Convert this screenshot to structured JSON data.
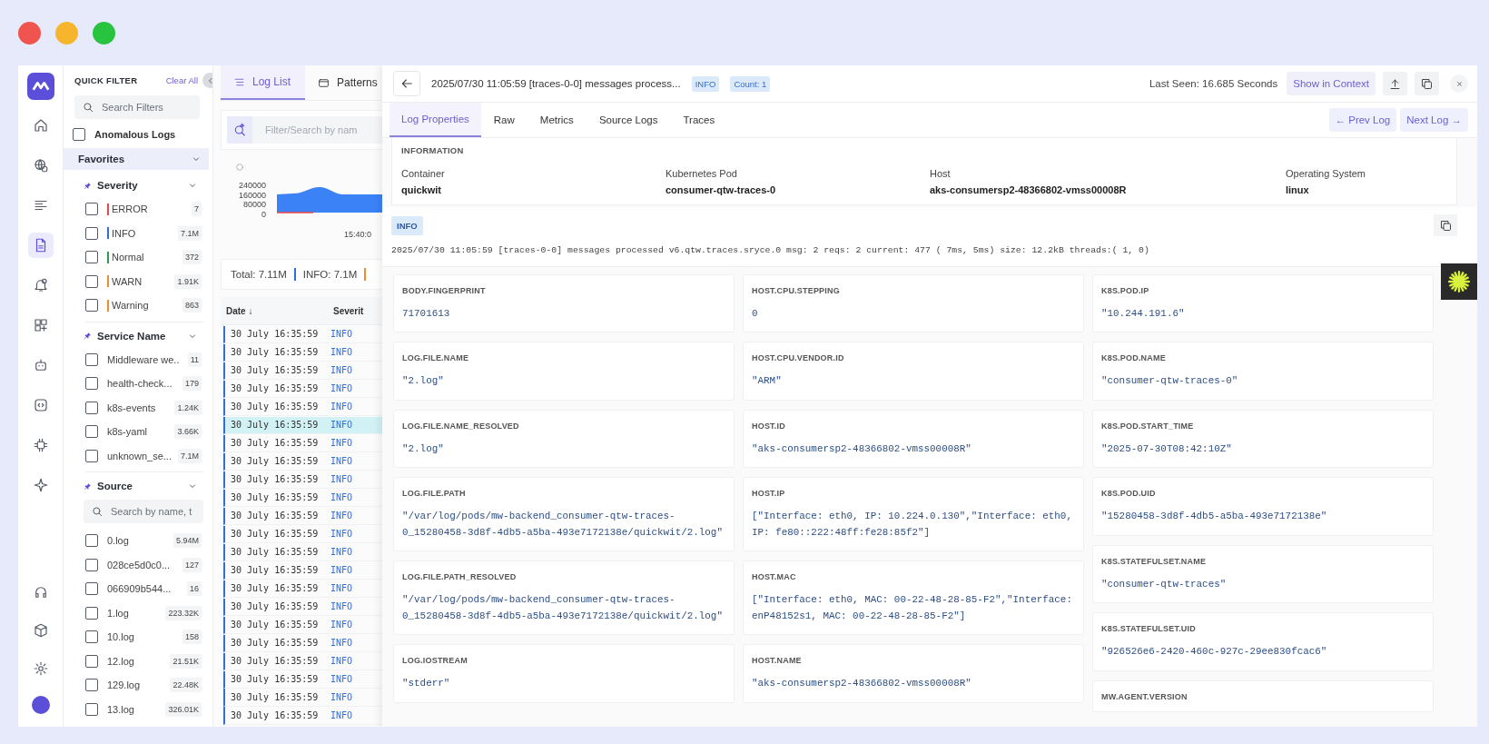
{
  "nav": {
    "items": [
      {
        "kind": "home",
        "selected": false
      },
      {
        "kind": "globe",
        "selected": false
      },
      {
        "kind": "list",
        "selected": false
      },
      {
        "kind": "document",
        "selected": true
      },
      {
        "kind": "bell",
        "selected": false
      },
      {
        "kind": "widget",
        "selected": false
      },
      {
        "kind": "robot",
        "selected": false
      },
      {
        "kind": "code",
        "selected": false
      },
      {
        "kind": "chip",
        "selected": false
      },
      {
        "kind": "sparkle",
        "selected": false
      }
    ],
    "bottom_items": [
      {
        "kind": "headset",
        "selected": false
      },
      {
        "kind": "cube",
        "selected": false
      },
      {
        "kind": "gear",
        "selected": false
      },
      {
        "kind": "avatar",
        "selected": false
      }
    ]
  },
  "filter_panel": {
    "title": "QUICK FILTER",
    "clear_label": "Clear All",
    "search": {
      "placeholder": "Search Filters"
    },
    "anomalous": {
      "label": "Anomalous Logs",
      "checked": false
    },
    "favorites": {
      "label": "Favorites",
      "expanded": true
    },
    "groups": [
      {
        "title": "Severity",
        "pinned": true,
        "expanded": true,
        "options": [
          {
            "label": "ERROR",
            "count": "7",
            "checked": false,
            "color": "#e5484d"
          },
          {
            "label": "INFO",
            "count": "7.1M",
            "checked": false,
            "color": "#2f6fdb"
          },
          {
            "label": "Normal",
            "count": "372",
            "checked": false,
            "color": "#2e9d4f"
          },
          {
            "label": "WARN",
            "count": "1.91K",
            "checked": false,
            "color": "#f08c2e"
          },
          {
            "label": "Warning",
            "count": "863",
            "checked": false,
            "color": "#f08c2e"
          }
        ]
      },
      {
        "title": "Service Name",
        "pinned": true,
        "expanded": true,
        "options": [
          {
            "label": "Middleware we..",
            "count": "11",
            "checked": false
          },
          {
            "label": "health-check...",
            "count": "179",
            "checked": false
          },
          {
            "label": "k8s-events",
            "count": "1.24K",
            "checked": false
          },
          {
            "label": "k8s-yaml",
            "count": "3.66K",
            "checked": false
          },
          {
            "label": "unknown_se...",
            "count": "7.1M",
            "checked": false
          }
        ]
      },
      {
        "title": "Source",
        "pinned": true,
        "expanded": true,
        "search": {
          "placeholder": "Search by name, t"
        },
        "options": [
          {
            "label": "0.log",
            "count": "5.94M",
            "checked": false
          },
          {
            "label": "028ce5d0c0...",
            "count": "127",
            "checked": false
          },
          {
            "label": "066909b544...",
            "count": "16",
            "checked": false
          },
          {
            "label": "1.log",
            "count": "223.32K",
            "checked": false
          },
          {
            "label": "10.log",
            "count": "158",
            "checked": false
          },
          {
            "label": "12.log",
            "count": "21.51K",
            "checked": false
          },
          {
            "label": "129.log",
            "count": "22.48K",
            "checked": false
          },
          {
            "label": "13.log",
            "count": "326.01K",
            "checked": false
          }
        ]
      }
    ]
  },
  "log_list": {
    "tabs": [
      {
        "label": "Log List",
        "kind": "list",
        "selected": true
      },
      {
        "label": "Patterns",
        "kind": "pattern",
        "selected": false
      }
    ],
    "search": {
      "placeholder": "Filter/Search by nam"
    },
    "chart": {
      "ytick_labels": [
        "240000",
        "160000",
        "80000",
        "0"
      ],
      "xtick_label": "15:40:0"
    },
    "summary": {
      "total": "Total: 7.11M",
      "items": [
        {
          "label": "INFO: 7.1M",
          "color": "#2f6fdb"
        },
        {
          "color": "#f08c2e"
        }
      ]
    },
    "columns": [
      "Date ↓",
      "Severit"
    ],
    "rows": [
      {
        "date": "30 July 16:35:59",
        "severity": "INFO",
        "selected": false
      },
      {
        "date": "30 July 16:35:59",
        "severity": "INFO",
        "selected": false
      },
      {
        "date": "30 July 16:35:59",
        "severity": "INFO",
        "selected": false
      },
      {
        "date": "30 July 16:35:59",
        "severity": "INFO",
        "selected": false
      },
      {
        "date": "30 July 16:35:59",
        "severity": "INFO",
        "selected": false
      },
      {
        "date": "30 July 16:35:59",
        "severity": "INFO",
        "selected": true
      },
      {
        "date": "30 July 16:35:59",
        "severity": "INFO",
        "selected": false
      },
      {
        "date": "30 July 16:35:59",
        "severity": "INFO",
        "selected": false
      },
      {
        "date": "30 July 16:35:59",
        "severity": "INFO",
        "selected": false
      },
      {
        "date": "30 July 16:35:59",
        "severity": "INFO",
        "selected": false
      },
      {
        "date": "30 July 16:35:59",
        "severity": "INFO",
        "selected": false
      },
      {
        "date": "30 July 16:35:59",
        "severity": "INFO",
        "selected": false
      },
      {
        "date": "30 July 16:35:59",
        "severity": "INFO",
        "selected": false
      },
      {
        "date": "30 July 16:35:59",
        "severity": "INFO",
        "selected": false
      },
      {
        "date": "30 July 16:35:59",
        "severity": "INFO",
        "selected": false
      },
      {
        "date": "30 July 16:35:59",
        "severity": "INFO",
        "selected": false
      },
      {
        "date": "30 July 16:35:59",
        "severity": "INFO",
        "selected": false
      },
      {
        "date": "30 July 16:35:59",
        "severity": "INFO",
        "selected": false
      },
      {
        "date": "30 July 16:35:59",
        "severity": "INFO",
        "selected": false
      },
      {
        "date": "30 July 16:35:59",
        "severity": "INFO",
        "selected": false
      },
      {
        "date": "30 July 16:35:59",
        "severity": "INFO",
        "selected": false
      },
      {
        "date": "30 July 16:35:59",
        "severity": "INFO",
        "selected": false
      }
    ]
  },
  "detail": {
    "title": "2025/07/30 11:05:59 [traces-0-0] messages process...",
    "badges": [
      "INFO",
      "Count: 1"
    ],
    "last_seen": "Last Seen: 16.685 Seconds",
    "actions": [
      {
        "kind": "text",
        "label": "Show in Context"
      },
      {
        "kind": "upload"
      },
      {
        "kind": "copy"
      },
      {
        "kind": "close"
      }
    ],
    "tabs": [
      {
        "label": "Log Properties",
        "selected": true
      },
      {
        "label": "Raw",
        "selected": false
      },
      {
        "label": "Metrics",
        "selected": false
      },
      {
        "label": "Source Logs",
        "selected": false
      },
      {
        "label": "Traces",
        "selected": false
      }
    ],
    "nav_buttons": [
      "← Prev Log",
      "Next Log →"
    ],
    "information": {
      "title": "INFORMATION",
      "fields": [
        {
          "label": "Container",
          "value": "quickwit"
        },
        {
          "label": "Kubernetes Pod",
          "value": "consumer-qtw-traces-0"
        },
        {
          "label": "Host",
          "value": "aks-consumersp2-48366802-vmss00008R"
        },
        {
          "label": "Operating System",
          "value": "linux"
        }
      ]
    },
    "message": {
      "severity": "INFO",
      "text": "2025/07/30 11:05:59 [traces-0-0] messages processed v6.qtw.traces.sryce.0 msg: 2 reqs: 2 current: 477 ( 7ms, 5ms) size: 12.2kB threads:( 1, 0)"
    },
    "attribute_columns": [
      [
        {
          "key": "BODY.FINGERPRINT",
          "value": "71701613"
        },
        {
          "key": "LOG.FILE.NAME",
          "value": "\"2.log\""
        },
        {
          "key": "LOG.FILE.NAME_RESOLVED",
          "value": "\"2.log\""
        },
        {
          "key": "LOG.FILE.PATH",
          "value": "\"/var/log/pods/mw-backend_consumer-qtw-traces-0_15280458-3d8f-4db5-a5ba-493e7172138e/quickwit/2.log\""
        },
        {
          "key": "LOG.FILE.PATH_RESOLVED",
          "value": "\"/var/log/pods/mw-backend_consumer-qtw-traces-0_15280458-3d8f-4db5-a5ba-493e7172138e/quickwit/2.log\""
        },
        {
          "key": "LOG.IOSTREAM",
          "value": "\"stderr\""
        }
      ],
      [
        {
          "key": "HOST.CPU.STEPPING",
          "value": "0"
        },
        {
          "key": "HOST.CPU.VENDOR.ID",
          "value": "\"ARM\""
        },
        {
          "key": "HOST.ID",
          "value": "\"aks-consumersp2-48366802-vmss00008R\""
        },
        {
          "key": "HOST.IP",
          "value": "[\"Interface: eth0, IP: 10.224.0.130\",\"Interface: eth0, IP: fe80::222:48ff:fe28:85f2\"]"
        },
        {
          "key": "HOST.MAC",
          "value": "[\"Interface: eth0, MAC: 00-22-48-28-85-F2\",\"Interface: enP48152s1, MAC: 00-22-48-28-85-F2\"]"
        },
        {
          "key": "HOST.NAME",
          "value": "\"aks-consumersp2-48366802-vmss00008R\""
        }
      ],
      [
        {
          "key": "K8S.POD.IP",
          "value": "\"10.244.191.6\""
        },
        {
          "key": "K8S.POD.NAME",
          "value": "\"consumer-qtw-traces-0\""
        },
        {
          "key": "K8S.POD.START_TIME",
          "value": "\"2025-07-30T08:42:10Z\""
        },
        {
          "key": "K8S.POD.UID",
          "value": "\"15280458-3d8f-4db5-a5ba-493e7172138e\""
        },
        {
          "key": "K8S.STATEFULSET.NAME",
          "value": "\"consumer-qtw-traces\""
        },
        {
          "key": "K8S.STATEFULSET.UID",
          "value": "\"926526e6-2420-460c-927c-29ee830fcac6\""
        },
        {
          "key": "MW.AGENT.VERSION"
        }
      ]
    ]
  }
}
